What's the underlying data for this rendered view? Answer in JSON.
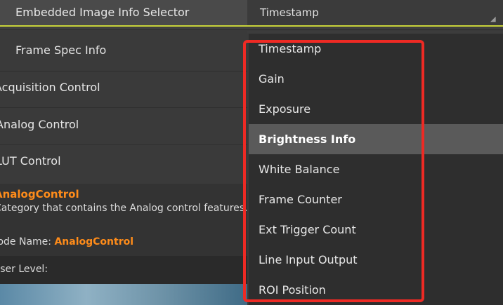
{
  "top_row": {
    "name": "Embedded Image Info Selector",
    "value": "Timestamp",
    "resize_glyph": "◢"
  },
  "tree": {
    "items": [
      {
        "label": "Frame Spec Info"
      },
      {
        "label": "Acquisition Control"
      },
      {
        "label": "Analog Control"
      },
      {
        "label": "LUT Control"
      }
    ]
  },
  "description": {
    "title": "AnalogControl",
    "text": "Category that contains the Analog control features.",
    "node_name_label": "Node Name:",
    "node_name_value": "AnalogControl",
    "user_level_label": "User Level:"
  },
  "dropdown": {
    "options": [
      "Timestamp",
      "Gain",
      "Exposure",
      "Brightness Info",
      "White Balance",
      "Frame Counter",
      "Ext Trigger Count",
      "Line Input Output",
      "ROI Position"
    ],
    "highlighted": "Brightness Info"
  },
  "colors": {
    "accent_underline": "#c8d33a",
    "highlight_border": "#ee2a24",
    "description_title": "#ff8c1a"
  }
}
